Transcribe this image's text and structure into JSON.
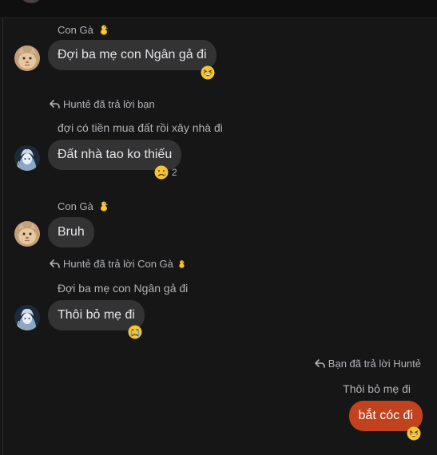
{
  "colors": {
    "background": "#161616",
    "incoming_bubble": "#333333",
    "outgoing_bubble": "#c0431d",
    "secondary_text": "#b0b3b8"
  },
  "messages": [
    {
      "sender": "Con Gà",
      "sender_badge_icon": "chick-emoji",
      "text": "Đợi ba mẹ con Ngân gả đi",
      "reaction_icon": "grinning-squint-emoji"
    },
    {
      "reply_label": "Huntẻ đã trả lời bạn",
      "quoted_text": "đợi có tiền mua đất rồi xây nhà đi",
      "text": "Đất nhà tao ko thiếu",
      "reaction_icon": "sad-emoji",
      "reaction_count": "2"
    },
    {
      "sender": "Con Gà",
      "sender_badge_icon": "chick-emoji",
      "text": "Bruh"
    },
    {
      "reply_label": "Huntẻ đã trả lời Con Gà",
      "reply_badge_icon": "chick-emoji",
      "quoted_text": "Đợi ba mẹ con Ngân gả đi",
      "text": "Thôi bỏ mẹ đi",
      "reaction_icon": "crying-emoji"
    },
    {
      "reply_label": "Bạn đã trả lời Huntẻ",
      "quoted_text": "Thôi bỏ mẹ đi",
      "text": "bắt cóc đi",
      "reaction_icon": "grinning-squint-emoji"
    }
  ]
}
